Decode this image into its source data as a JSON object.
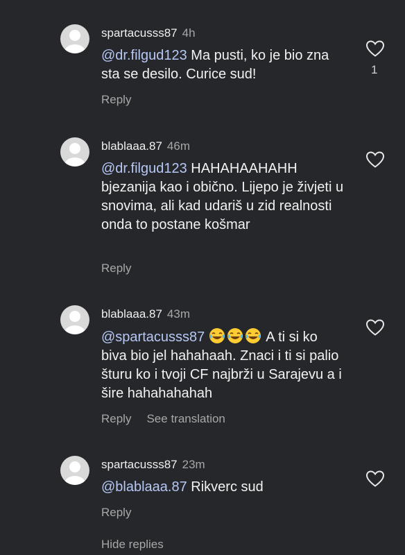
{
  "comments": [
    {
      "username": "spartacusss87",
      "time": "4h",
      "mention": "@dr.filgud123",
      "text": "Ma pusti, ko je bio zna sta se desilo. Curice sud!",
      "reply_label": "Reply",
      "likes": "1"
    },
    {
      "username": "blablaaa.87",
      "time": "46m",
      "mention": "@dr.filgud123",
      "text": "HAHAHAAHAHH bjezanija kao i obično. Lijepo je živjeti u snovima, ali kad udariš u zid realnosti onda to postane košmar",
      "reply_label": "Reply"
    },
    {
      "username": "blablaaa.87",
      "time": "43m",
      "mention": "@spartacusss87",
      "emoji": "face-with-tears-of-joy x3",
      "text": "A ti si ko biva bio jel hahahaah. Znaci i ti si palio šturu ko i tvoji CF najbrži u Sarajevu a i šire hahahahahah",
      "reply_label": "Reply",
      "translate_label": "See translation"
    },
    {
      "username": "spartacusss87",
      "time": "23m",
      "mention": "@blablaaa.87",
      "text": "Rikverc sud",
      "reply_label": "Reply"
    }
  ],
  "hide_replies_label": "Hide replies",
  "colors": {
    "background": "#25272b",
    "mention": "#b7c8f5",
    "muted": "#a8a8a8"
  },
  "icons": {
    "like": "heart-outline-icon",
    "avatar": "default-avatar-icon"
  }
}
